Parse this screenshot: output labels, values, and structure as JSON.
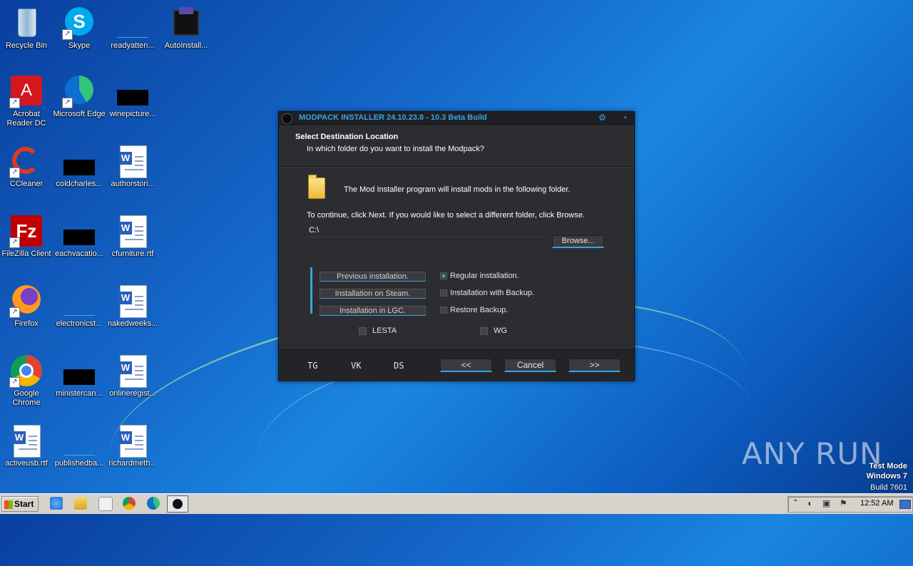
{
  "desktop": {
    "icons": [
      {
        "label": "Recycle Bin"
      },
      {
        "label": "Skype"
      },
      {
        "label": "readyatten..."
      },
      {
        "label": "AutoInstall..."
      },
      {
        "label": "Acrobat Reader DC"
      },
      {
        "label": "Microsoft Edge"
      },
      {
        "label": "winepicture..."
      },
      {
        "label": "CCleaner"
      },
      {
        "label": "coldcharles..."
      },
      {
        "label": "authorstori..."
      },
      {
        "label": "FileZilla Client"
      },
      {
        "label": "eachvacatio..."
      },
      {
        "label": "cfurniture.rtf"
      },
      {
        "label": "Firefox"
      },
      {
        "label": "electronicst..."
      },
      {
        "label": "nakedweeks..."
      },
      {
        "label": "Google Chrome"
      },
      {
        "label": "ministercan..."
      },
      {
        "label": "onlineregist..."
      },
      {
        "label": "activeusb.rtf"
      },
      {
        "label": "publishedba..."
      },
      {
        "label": "richardmeth..."
      }
    ]
  },
  "dialog": {
    "title": "MODPACK INSTALLER 24.10.23.8  - 10.3 Beta Build",
    "heading": "Select Destination Location",
    "subheading": "In which folder do you want to install the Modpack?",
    "intro": "The Mod Installer program will install mods in the following folder.",
    "instruction": "To continue, click Next. If you would like to select a different folder, click Browse.",
    "path_value": "C:\\",
    "browse_label": "Browse...",
    "option_buttons": [
      "Previous installation.",
      "Installation on Steam.",
      "Installation in LGC."
    ],
    "radios": [
      "Regular installation.",
      "Installation with Backup.",
      "Restore Backup."
    ],
    "checkboxes": [
      "LESTA",
      "WG"
    ],
    "footer_links": [
      "TG",
      "VK",
      "DS"
    ],
    "back_label": "<<",
    "cancel_label": "Cancel",
    "next_label": ">>"
  },
  "taskbar": {
    "start_label": "Start",
    "clock": "12:52 AM"
  },
  "watermark": {
    "brand": "ANY RUN",
    "line1": "Test Mode",
    "line2": "Windows 7",
    "line3": "Build 7601"
  },
  "colors": {
    "accent": "#36a4e6",
    "dialog_bg": "#2c2d30"
  }
}
